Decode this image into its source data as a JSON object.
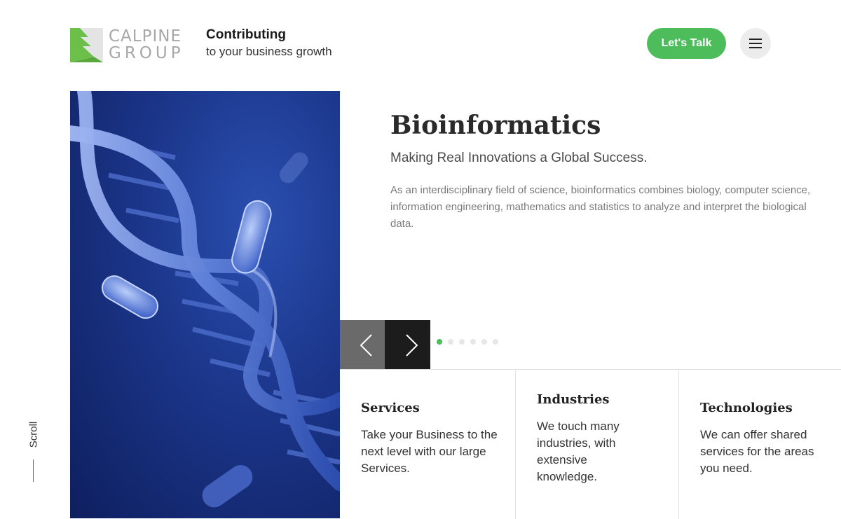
{
  "header": {
    "logo": {
      "line1": "CALPINE",
      "line2": "GROUP",
      "green": "#6cc04a"
    },
    "tagline": {
      "title": "Contributing",
      "subtitle": "to your business growth"
    },
    "cta_label": "Let's Talk",
    "menu_icon": "hamburger-icon"
  },
  "hero": {
    "image_subject": "dna-helix-with-bacteria",
    "title": "Bioinformatics",
    "subtitle": "Making Real Innovations a Global Success.",
    "description": "As an interdisciplinary field of science, bioinformatics combines biology, computer science, information engineering, mathematics and statistics to analyze and interpret the biological data."
  },
  "slider": {
    "prev_icon": "chevron-left-icon",
    "next_icon": "chevron-right-icon",
    "dot_count": 6,
    "active_index": 0
  },
  "cards": [
    {
      "title": "Services",
      "text": "Take your Business to the next level with our large Services."
    },
    {
      "title": "Industries",
      "text": "We touch many industries, with extensive knowledge."
    },
    {
      "title": "Technologies",
      "text": "We can offer shared services for the areas you need."
    }
  ],
  "scroll": {
    "label": "Scroll"
  },
  "colors": {
    "accent": "#4cbd5a",
    "dark": "#1c1c1c",
    "grey_button": "#6a6a6a"
  }
}
